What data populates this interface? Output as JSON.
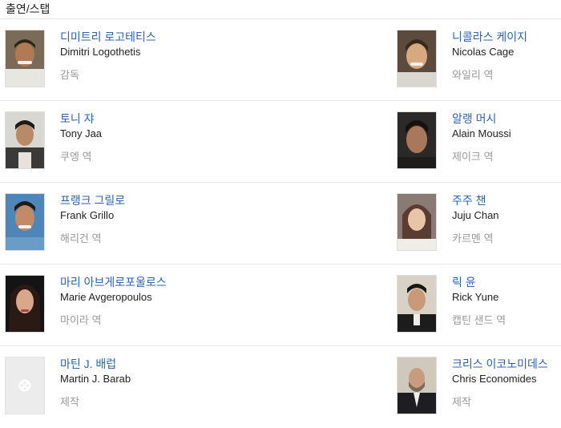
{
  "section": {
    "title": "출연/스탭"
  },
  "rows": [
    {
      "left": {
        "name_ko": "디미트리 로고테티스",
        "name_en": "Dimitri Logothetis",
        "role": "감독"
      },
      "right": {
        "name_ko": "니콜라스 케이지",
        "name_en": "Nicolas Cage",
        "role": "와일리 역"
      }
    },
    {
      "left": {
        "name_ko": "토니 쟈",
        "name_en": "Tony Jaa",
        "role": "쿠엥 역"
      },
      "right": {
        "name_ko": "알랭 머시",
        "name_en": "Alain Moussi",
        "role": "제이크 역"
      }
    },
    {
      "left": {
        "name_ko": "프랭크 그릴로",
        "name_en": "Frank Grillo",
        "role": "해리건 역"
      },
      "right": {
        "name_ko": "주주 챈",
        "name_en": "Juju Chan",
        "role": "카르멘 역"
      }
    },
    {
      "left": {
        "name_ko": "마리 아브게로포울로스",
        "name_en": "Marie Avgeropoulos",
        "role": "마이라 역"
      },
      "right": {
        "name_ko": "릭 윤",
        "name_en": "Rick Yune",
        "role": "캡틴 샌드 역"
      }
    },
    {
      "left": {
        "name_ko": "마틴 J. 배럽",
        "name_en": "Martin J. Barab",
        "role": "제작"
      },
      "right": {
        "name_ko": "크리스 이코노미데스",
        "name_en": "Chris Economides",
        "role": "제작"
      }
    }
  ],
  "icons": {
    "placeholder": "film-reel-icon"
  },
  "colors": {
    "link": "#2a63b4",
    "text": "#222222",
    "muted": "#999999",
    "divider": "#e9e9e9",
    "placeholder_bg": "#ececec"
  }
}
